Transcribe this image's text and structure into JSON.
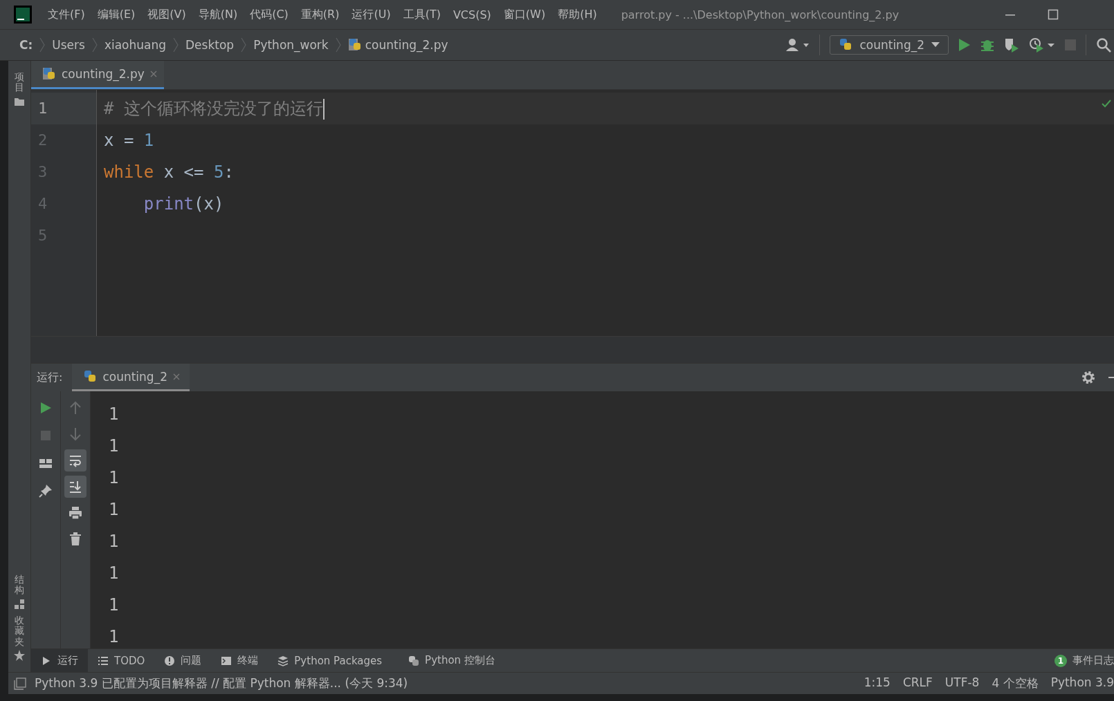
{
  "window": {
    "title": "parrot.py - ...\\Desktop\\Python_work\\counting_2.py"
  },
  "menu": [
    "文件(F)",
    "编辑(E)",
    "视图(V)",
    "导航(N)",
    "代码(C)",
    "重构(R)",
    "运行(U)",
    "工具(T)",
    "VCS(S)",
    "窗口(W)",
    "帮助(H)"
  ],
  "breadcrumbs": [
    {
      "label": "C:",
      "kind": "drive"
    },
    {
      "label": "Users",
      "kind": "folder"
    },
    {
      "label": "xiaohuang",
      "kind": "folder"
    },
    {
      "label": "Desktop",
      "kind": "folder"
    },
    {
      "label": "Python_work",
      "kind": "folder"
    },
    {
      "label": "counting_2.py",
      "kind": "file"
    }
  ],
  "run_config": {
    "label": "counting_2"
  },
  "left_strip": [
    {
      "label": "项目",
      "kind": "folder"
    },
    {
      "label": "结构",
      "kind": "structure"
    },
    {
      "label": "收藏夹",
      "kind": "star"
    }
  ],
  "editor_tabs": [
    {
      "label": "counting_2.py",
      "selected": true
    }
  ],
  "code": [
    {
      "number": "1",
      "current": true,
      "has_caret": true,
      "tokens": [
        {
          "kind": "comment",
          "text": "# 这个循环将没完没了的运行"
        }
      ]
    },
    {
      "number": "2",
      "current": false,
      "has_caret": false,
      "tokens": [
        {
          "kind": "plain",
          "text": "x = "
        },
        {
          "kind": "number",
          "text": "1"
        }
      ]
    },
    {
      "number": "3",
      "current": false,
      "has_caret": false,
      "tokens": [
        {
          "kind": "keyword",
          "text": "while"
        },
        {
          "kind": "plain",
          "text": " x <= "
        },
        {
          "kind": "number",
          "text": "5"
        },
        {
          "kind": "plain",
          "text": ":"
        }
      ]
    },
    {
      "number": "4",
      "current": false,
      "has_caret": false,
      "tokens": [
        {
          "kind": "builtin",
          "text": "    print"
        },
        {
          "kind": "plain",
          "text": "(x)"
        }
      ]
    },
    {
      "number": "5",
      "current": false,
      "has_caret": false
    }
  ],
  "run_panel": {
    "label": "运行:",
    "tabs": [
      {
        "label": "counting_2",
        "selected": true
      }
    ],
    "tools_left": [
      {
        "kind": "run",
        "disabled": false
      },
      {
        "kind": "stop",
        "disabled": true
      },
      {
        "kind": "layout",
        "disabled": false
      },
      {
        "kind": "pin",
        "disabled": false
      }
    ],
    "tools_right": [
      {
        "kind": "up",
        "disabled": true,
        "toggled": false
      },
      {
        "kind": "down",
        "disabled": true,
        "toggled": false
      },
      {
        "kind": "wrap",
        "disabled": false,
        "toggled": true
      },
      {
        "kind": "scroll-end",
        "disabled": false,
        "toggled": true
      },
      {
        "kind": "print",
        "disabled": false,
        "toggled": false
      },
      {
        "kind": "trash",
        "disabled": false,
        "toggled": false
      }
    ],
    "output": [
      "1",
      "1",
      "1",
      "1",
      "1",
      "1",
      "1",
      "1"
    ]
  },
  "tool_windows": [
    {
      "label": "运行",
      "kind": "run",
      "selected": true
    },
    {
      "label": "TODO",
      "kind": "list",
      "selected": false
    },
    {
      "label": "问题",
      "kind": "problem",
      "selected": false
    },
    {
      "label": "终端",
      "kind": "terminal",
      "selected": false
    },
    {
      "label": "Python Packages",
      "kind": "packages",
      "selected": false
    },
    {
      "label": "Python 控制台",
      "kind": "python",
      "selected": false
    }
  ],
  "event_log": {
    "count": "1",
    "label": "事件日志"
  },
  "status_bar": {
    "message": "Python 3.9 已配置为项目解释器 // 配置 Python 解释器... (今天 9:34)",
    "items": [
      "1:15",
      "CRLF",
      "UTF-8",
      "4 个空格",
      "Python 3.9"
    ]
  }
}
